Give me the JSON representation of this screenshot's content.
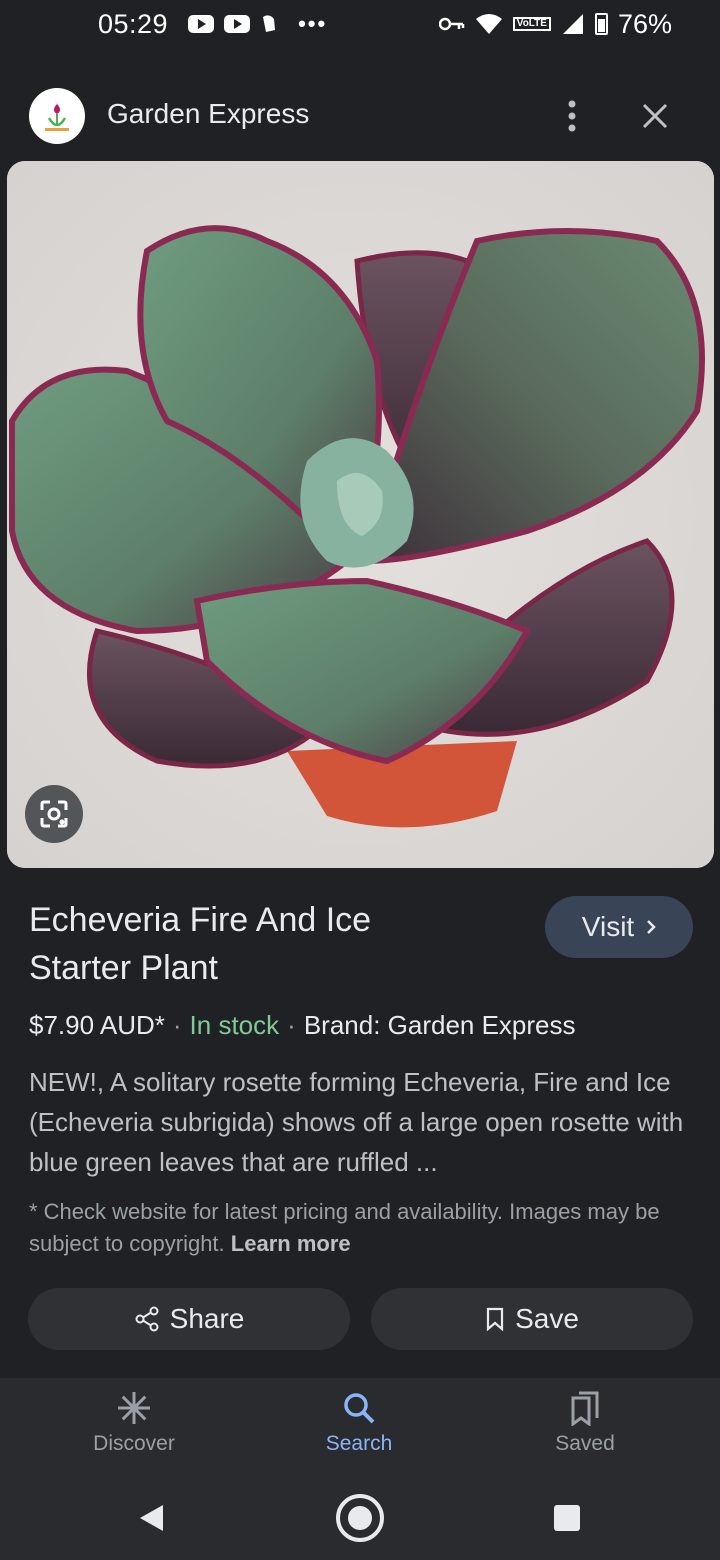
{
  "status_bar": {
    "time": "05:29",
    "battery": "76%",
    "network_badge": "VoLTE"
  },
  "header": {
    "site_name": "Garden Express",
    "logo_icon": "garden-express-logo"
  },
  "product": {
    "title_line1": "Echeveria Fire And Ice",
    "title_line2": "Starter Plant",
    "visit_label": "Visit",
    "price": "$7.90 AUD*",
    "stock": "In stock",
    "brand": "Brand: Garden Express",
    "description": "NEW!, A solitary rosette forming Echeveria, Fire and Ice (Echeveria subrigida) shows off a large open rosette with blue green leaves that are ruffled ...",
    "disclaimer": "* Check website for latest pricing and availability. Images may be subject to copyright.",
    "learn_more": "Learn more"
  },
  "actions": {
    "share_label": "Share",
    "save_label": "Save"
  },
  "bottom_nav": {
    "items": [
      {
        "label": "Discover",
        "icon": "asterisk-icon",
        "active": false
      },
      {
        "label": "Search",
        "icon": "search-icon",
        "active": true
      },
      {
        "label": "Saved",
        "icon": "bookmarks-icon",
        "active": false
      }
    ]
  },
  "colors": {
    "background": "#202124",
    "accent": "#8ab4f8",
    "in_stock": "#81c995",
    "visit_button": "#394457"
  }
}
